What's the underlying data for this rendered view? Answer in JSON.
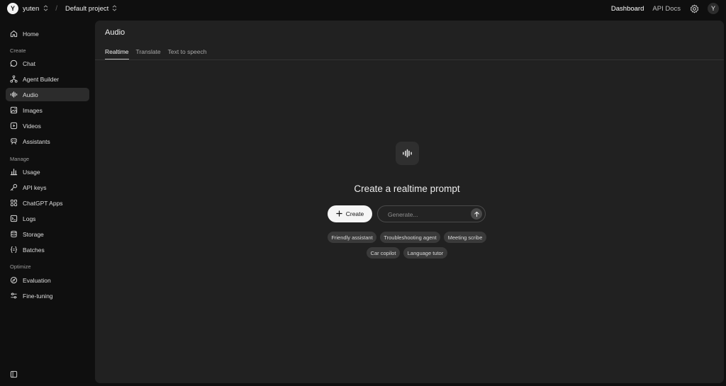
{
  "topbar": {
    "org_avatar": "Y",
    "org_name": "yuten",
    "separator": "/",
    "project_name": "Default project",
    "links": {
      "dashboard": "Dashboard",
      "api_docs": "API Docs"
    },
    "user_avatar": "Y"
  },
  "sidebar": {
    "home": "Home",
    "sections": {
      "create": "Create",
      "manage": "Manage",
      "optimize": "Optimize"
    },
    "create_items": [
      "Chat",
      "Agent Builder",
      "Audio",
      "Images",
      "Videos",
      "Assistants"
    ],
    "manage_items": [
      "Usage",
      "API keys",
      "ChatGPT Apps",
      "Logs",
      "Storage",
      "Batches"
    ],
    "optimize_items": [
      "Evaluation",
      "Fine-tuning"
    ],
    "active_item": "Audio"
  },
  "main": {
    "title": "Audio",
    "tabs": [
      "Realtime",
      "Translate",
      "Text to speech"
    ],
    "active_tab": "Realtime",
    "headline": "Create a realtime prompt",
    "create_label": "Create",
    "generate_placeholder": "Generate...",
    "suggestions": [
      "Friendly assistant",
      "Troubleshooting agent",
      "Meeting scribe",
      "Car copilot",
      "Language tutor"
    ]
  },
  "icons": {
    "home": "home-icon",
    "chat": "chat-icon",
    "agent_builder": "agent-builder-icon",
    "audio": "audio-waveform-icon",
    "images": "image-icon",
    "videos": "video-icon",
    "assistants": "assistant-icon",
    "usage": "bar-chart-icon",
    "api_keys": "key-icon",
    "chatgpt_apps": "apps-grid-icon",
    "logs": "terminal-icon",
    "storage": "database-icon",
    "batches": "braces-icon",
    "evaluation": "compass-icon",
    "fine_tuning": "sliders-icon",
    "settings": "gear-icon",
    "collapse": "sidebar-collapse-icon"
  },
  "colors": {
    "background": "#0f0f0f",
    "panel": "#212121",
    "active_nav": "#2c2c2c",
    "accent_button": "#f5f5f5"
  }
}
